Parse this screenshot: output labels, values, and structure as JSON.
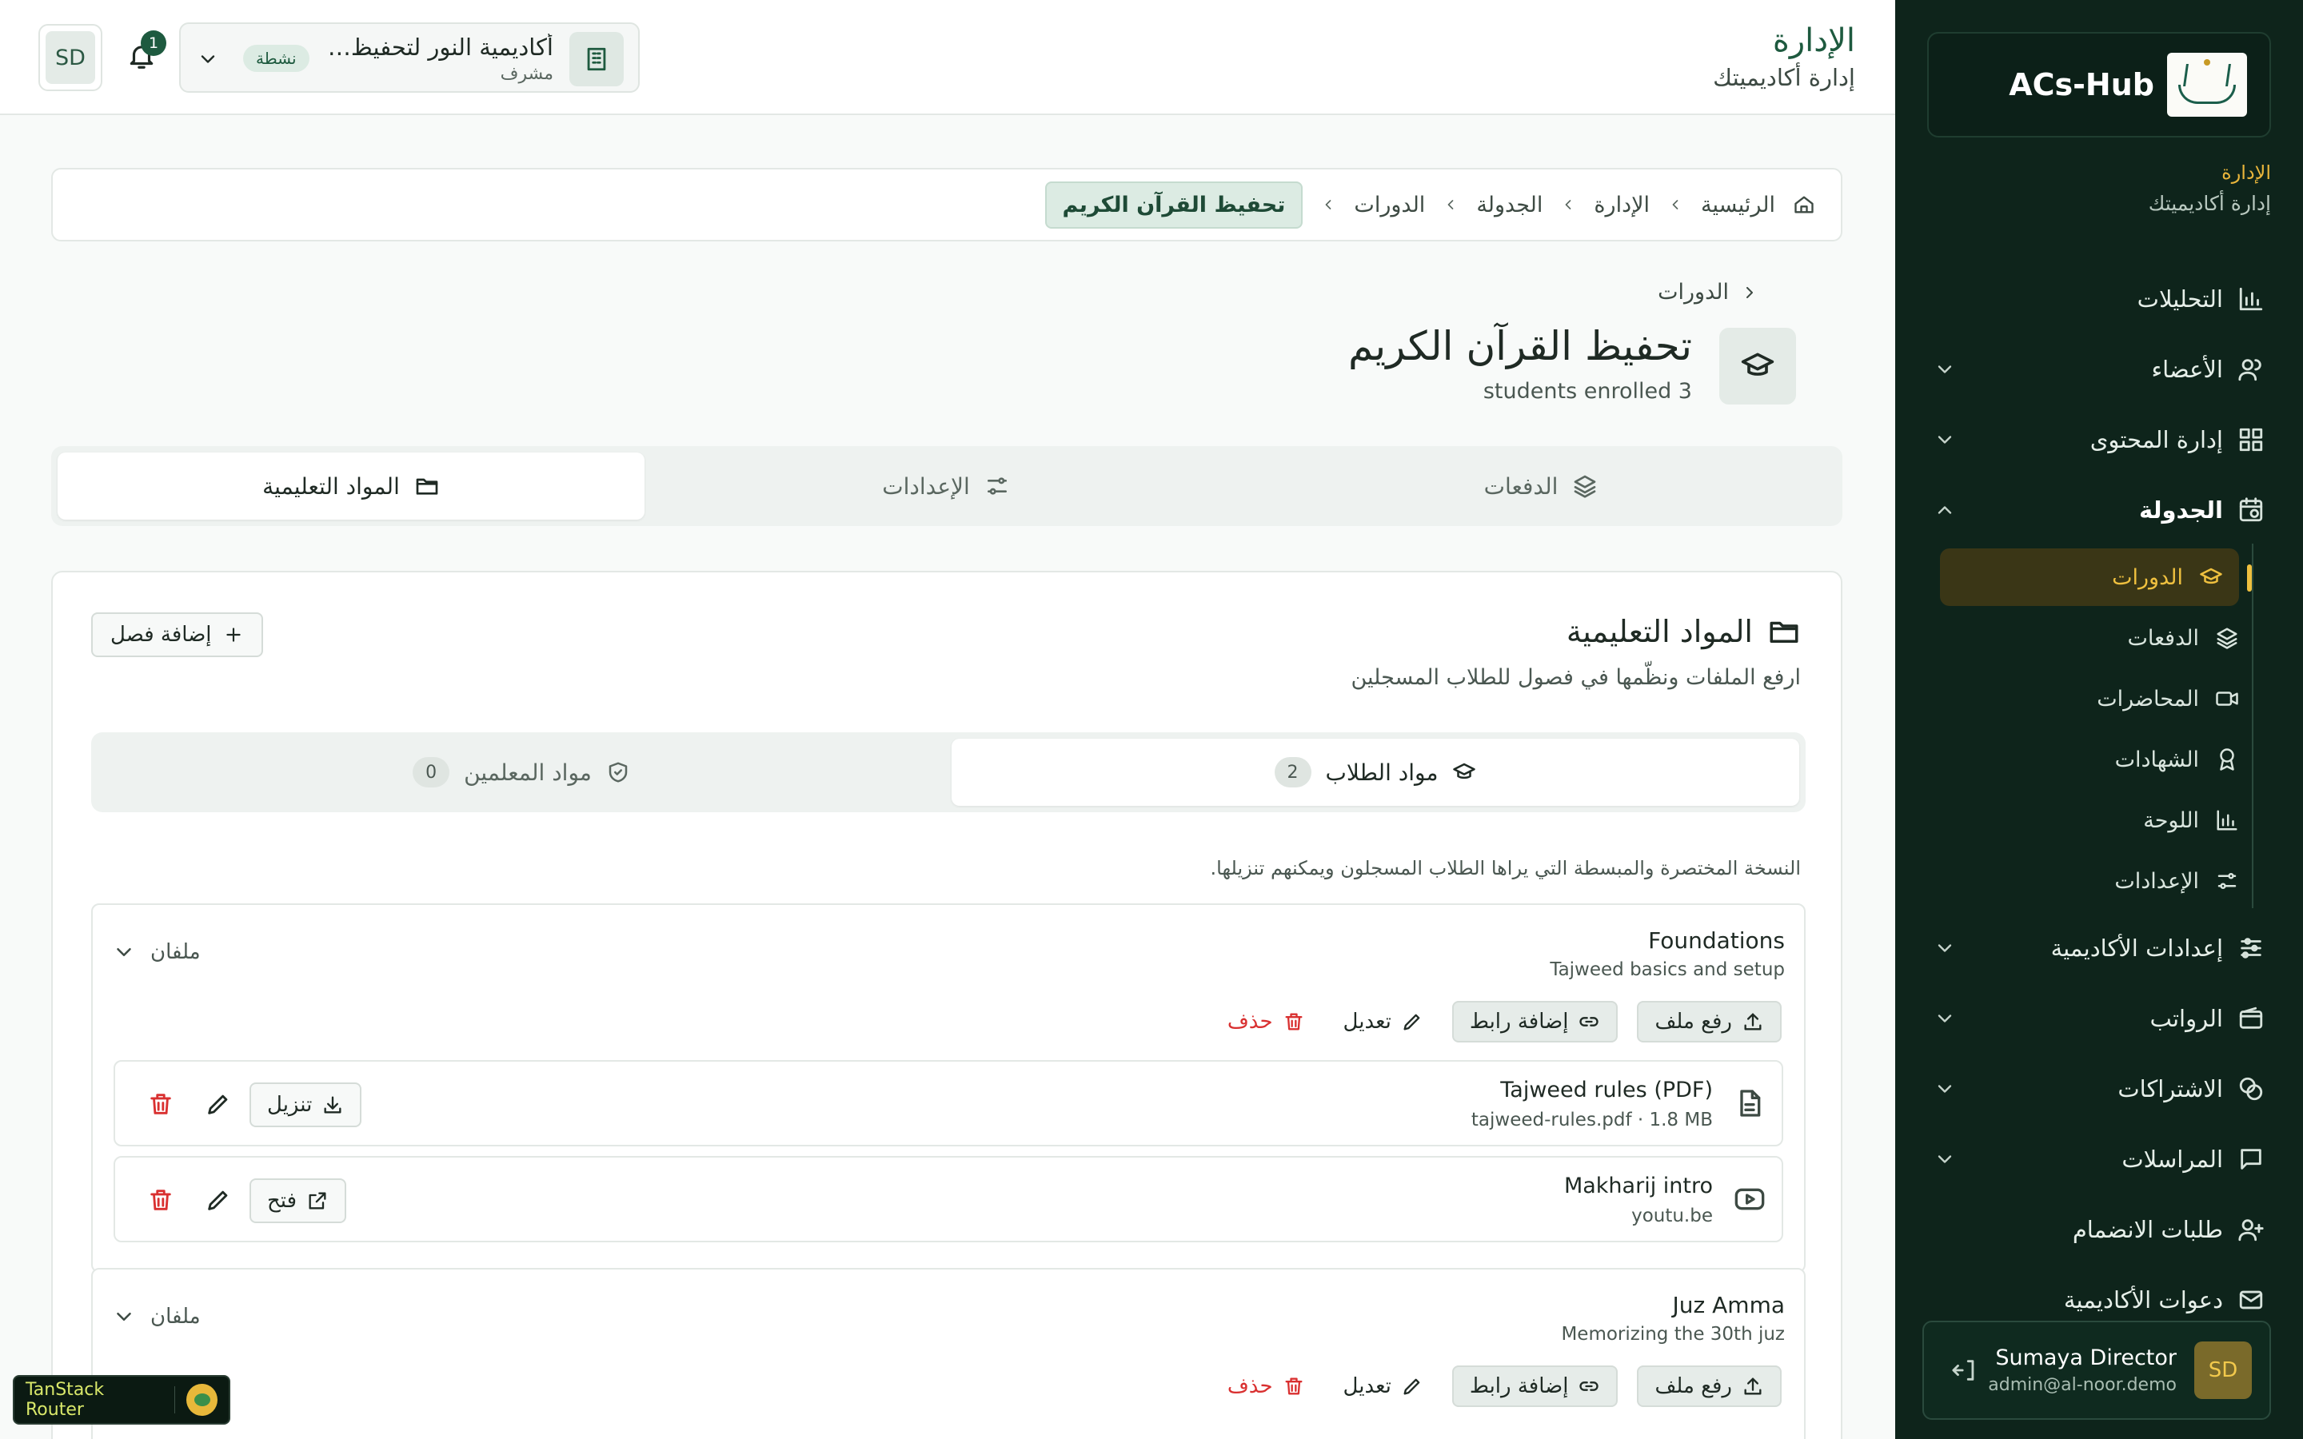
{
  "colors": {
    "sidebar_bg": "#0e241b",
    "accent_gold": "#efc03f",
    "brand_green": "#1e5a3f",
    "danger": "#d93030"
  },
  "sidebar": {
    "brand": "ACs-Hub",
    "section_title": "الإدارة",
    "section_subtitle": "إدارة أكاديميتك",
    "items": [
      {
        "label": "التحليلات",
        "icon": "bar-chart-icon",
        "expandable": false
      },
      {
        "label": "الأعضاء",
        "icon": "users-icon",
        "expandable": true
      },
      {
        "label": "إدارة المحتوى",
        "icon": "grid-icon",
        "expandable": true
      },
      {
        "label": "الجدولة",
        "icon": "calendar-clock-icon",
        "expandable": true,
        "expanded": true
      },
      {
        "label": "إعدادات الأكاديمية",
        "icon": "sliders-icon",
        "expandable": true
      },
      {
        "label": "الرواتب",
        "icon": "wallet-icon",
        "expandable": true
      },
      {
        "label": "الاشتراكات",
        "icon": "coins-icon",
        "expandable": true
      },
      {
        "label": "المراسلات",
        "icon": "message-icon",
        "expandable": true
      },
      {
        "label": "طلبات الانضمام",
        "icon": "user-plus-icon",
        "expandable": false
      },
      {
        "label": "دعوات الأكاديمية",
        "icon": "mail-icon",
        "expandable": false
      }
    ],
    "sub_items": [
      {
        "label": "الدورات",
        "icon": "graduation-cap-icon",
        "active": true
      },
      {
        "label": "الدفعات",
        "icon": "layers-icon"
      },
      {
        "label": "المحاضرات",
        "icon": "video-icon"
      },
      {
        "label": "الشهادات",
        "icon": "award-icon"
      },
      {
        "label": "اللوحة",
        "icon": "bar-chart-icon"
      },
      {
        "label": "الإعدادات",
        "icon": "settings-sliders-icon"
      }
    ],
    "user": {
      "initials": "SD",
      "name": "Sumaya Director",
      "email": "admin@al-noor.demo"
    }
  },
  "topbar": {
    "title": "الإدارة",
    "subtitle": "إدارة أكاديميتك",
    "avatar_initials": "SD",
    "notifications_count": "1",
    "academy": {
      "name": "أكاديمية النور لتحفيظ القرآن",
      "role": "مشرف",
      "status": "نشطة"
    }
  },
  "breadcrumb": {
    "items": [
      "الرئيسية",
      "الإدارة",
      "الجدولة",
      "الدورات"
    ],
    "current": "تحفيظ القرآن الكريم"
  },
  "course": {
    "back_label": "الدورات",
    "title": "تحفيظ القرآن الكريم",
    "subtitle": "students enrolled 3"
  },
  "tabs": [
    {
      "label": "المواد التعليمية",
      "icon": "folder-icon",
      "active": true
    },
    {
      "label": "الإعدادات",
      "icon": "settings-sliders-icon"
    },
    {
      "label": "الدفعات",
      "icon": "layers-icon"
    }
  ],
  "materials": {
    "title": "المواد التعليمية",
    "description": "ارفع الملفات ونظّمها في فصول للطلاب المسجلين",
    "add_chapter_label": "إضافة فصل",
    "sub_tabs": [
      {
        "label": "مواد الطلاب",
        "count": "2",
        "icon": "graduation-cap-icon",
        "active": true
      },
      {
        "label": "مواد المعلمين",
        "count": "0",
        "icon": "shield-check-icon"
      }
    ],
    "note": "النسخة المختصرة والمبسطة التي يراها الطلاب المسجلون ويمكنهم تنزيلها.",
    "actions": {
      "upload": "رفع ملف",
      "add_link": "إضافة رابط",
      "edit": "تعديل",
      "delete": "حذف",
      "download": "تنزيل",
      "open": "فتح"
    },
    "chapters": [
      {
        "title": "Foundations",
        "subtitle": "Tajweed basics and setup",
        "count_label": "ملفان",
        "files": [
          {
            "name": "Tajweed rules (PDF)",
            "meta": "tajweed-rules.pdf · 1.8 MB",
            "icon": "file-text-icon",
            "action": "تنزيل"
          },
          {
            "name": "Makharij intro",
            "meta": "youtu.be",
            "icon": "youtube-icon",
            "action": "فتح"
          }
        ]
      },
      {
        "title": "Juz Amma",
        "subtitle": "Memorizing the 30th juz",
        "count_label": "ملفان",
        "files": []
      }
    ]
  },
  "devtools": {
    "label": "TanStack Router"
  }
}
